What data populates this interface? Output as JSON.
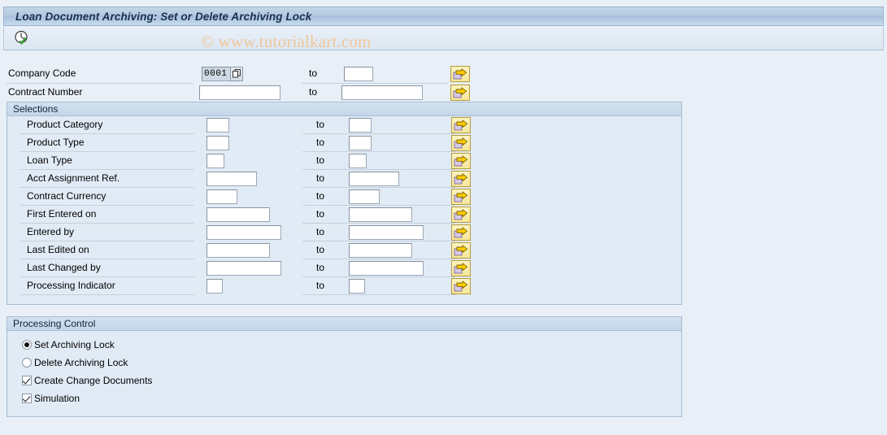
{
  "window": {
    "title": "Loan Document Archiving: Set or Delete Archiving Lock"
  },
  "toolbar": {
    "execute_icon": "clock-check-icon",
    "execute_tooltip": "Execute"
  },
  "watermark": {
    "text": "© www.tutorialkart.com",
    "color": "#f0c69a"
  },
  "top_fields": [
    {
      "label": "Company Code",
      "from_value": "0001",
      "to_value": "",
      "has_help": true,
      "from_width": 42,
      "to_width": 36,
      "multi_select_icon": "multi-selection-arrow-icon"
    },
    {
      "label": "Contract Number",
      "from_value": "",
      "to_value": "",
      "has_help": false,
      "from_width": 100,
      "to_width": 100,
      "multi_select_icon": "multi-selection-arrow-icon"
    }
  ],
  "selections_panel": {
    "header": "Selections",
    "to_label": "to",
    "rows": [
      {
        "label": "Product Category",
        "from_value": "",
        "to_value": "",
        "from_width": 28,
        "to_width": 28
      },
      {
        "label": "Product Type",
        "from_value": "",
        "to_value": "",
        "from_width": 28,
        "to_width": 28
      },
      {
        "label": "Loan Type",
        "from_value": "",
        "to_value": "",
        "from_width": 22,
        "to_width": 22
      },
      {
        "label": "Acct Assignment Ref.",
        "from_value": "",
        "to_value": "",
        "from_width": 62,
        "to_width": 62
      },
      {
        "label": "Contract Currency",
        "from_value": "",
        "to_value": "",
        "from_width": 38,
        "to_width": 38
      },
      {
        "label": "First Entered on",
        "from_value": "",
        "to_value": "",
        "from_width": 78,
        "to_width": 78
      },
      {
        "label": "Entered by",
        "from_value": "",
        "to_value": "",
        "from_width": 92,
        "to_width": 92
      },
      {
        "label": "Last Edited on",
        "from_value": "",
        "to_value": "",
        "from_width": 78,
        "to_width": 78
      },
      {
        "label": "Last Changed by",
        "from_value": "",
        "to_value": "",
        "from_width": 92,
        "to_width": 92
      },
      {
        "label": "Processing Indicator",
        "from_value": "",
        "to_value": "",
        "from_width": 20,
        "to_width": 20
      }
    ],
    "multi_select_icon": "multi-selection-arrow-icon"
  },
  "processing_control": {
    "header": "Processing Control",
    "options": [
      {
        "type": "radio",
        "label": "Set Archiving Lock",
        "checked": true
      },
      {
        "type": "radio",
        "label": "Delete Archiving Lock",
        "checked": false
      },
      {
        "type": "checkbox",
        "label": "Create Change Documents",
        "checked": true
      },
      {
        "type": "checkbox",
        "label": "Simulation",
        "checked": true
      }
    ]
  },
  "colors": {
    "background": "#e8eff7",
    "panel_background": "#e1ebf5",
    "title_text": "#1a3050",
    "button_yellow": "#f7e79a",
    "arrow_yellow": "#ffcc00"
  }
}
